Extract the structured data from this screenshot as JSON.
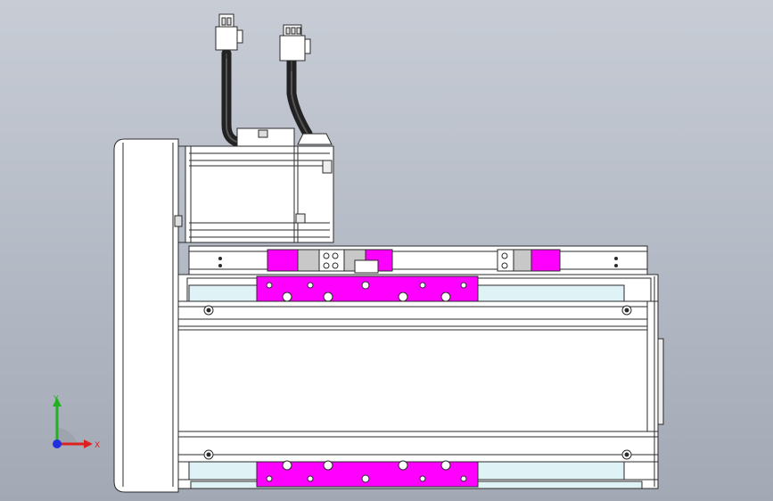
{
  "triad": {
    "x_label": "X",
    "y_label": "Y",
    "x_color": "#e02020",
    "y_color": "#20b020",
    "z_color": "#2030e0"
  },
  "colors": {
    "background_top": "#c7ccd5",
    "background_bottom": "#a2a9b5",
    "part_fill": "#ffffff",
    "edge": "#2a2a2a",
    "highlight_magenta": "#ff00ff",
    "rail_cyan": "#dff3f6",
    "gray_part": "#c8c8c8",
    "cable": "#222222"
  },
  "model": {
    "part_name": "linear-actuator-assembly",
    "view": "front"
  }
}
